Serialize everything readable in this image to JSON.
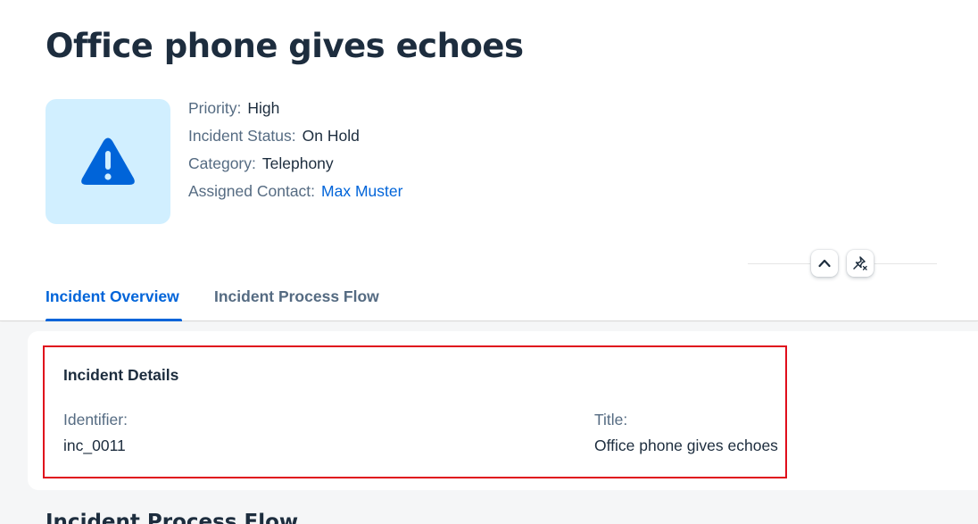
{
  "header": {
    "title": "Office phone gives echoes",
    "avatar_icon": "warning-triangle-icon",
    "attributes": [
      {
        "label": "Priority:",
        "value": "High"
      },
      {
        "label": "Incident Status:",
        "value": "On Hold"
      },
      {
        "label": "Category:",
        "value": "Telephony"
      },
      {
        "label": "Assigned Contact:",
        "value": "Max Muster"
      }
    ],
    "collapse_icon": "chevron-up-icon",
    "pin_icon": "unpin-icon"
  },
  "tabs": [
    {
      "label": "Incident Overview",
      "selected": true
    },
    {
      "label": "Incident Process Flow",
      "selected": false
    }
  ],
  "details": {
    "section_title": "Incident Details",
    "identifier_label": "Identifier:",
    "identifier_value": "inc_0011",
    "title_label": "Title:",
    "title_value": "Office phone gives echoes"
  },
  "next_section_title": "Incident Process Flow",
  "colors": {
    "accent": "#0064d9",
    "avatar_background": "#d1efff",
    "highlight_border": "#e00e1c",
    "text": "#1d2d3e",
    "label": "#556b82"
  }
}
